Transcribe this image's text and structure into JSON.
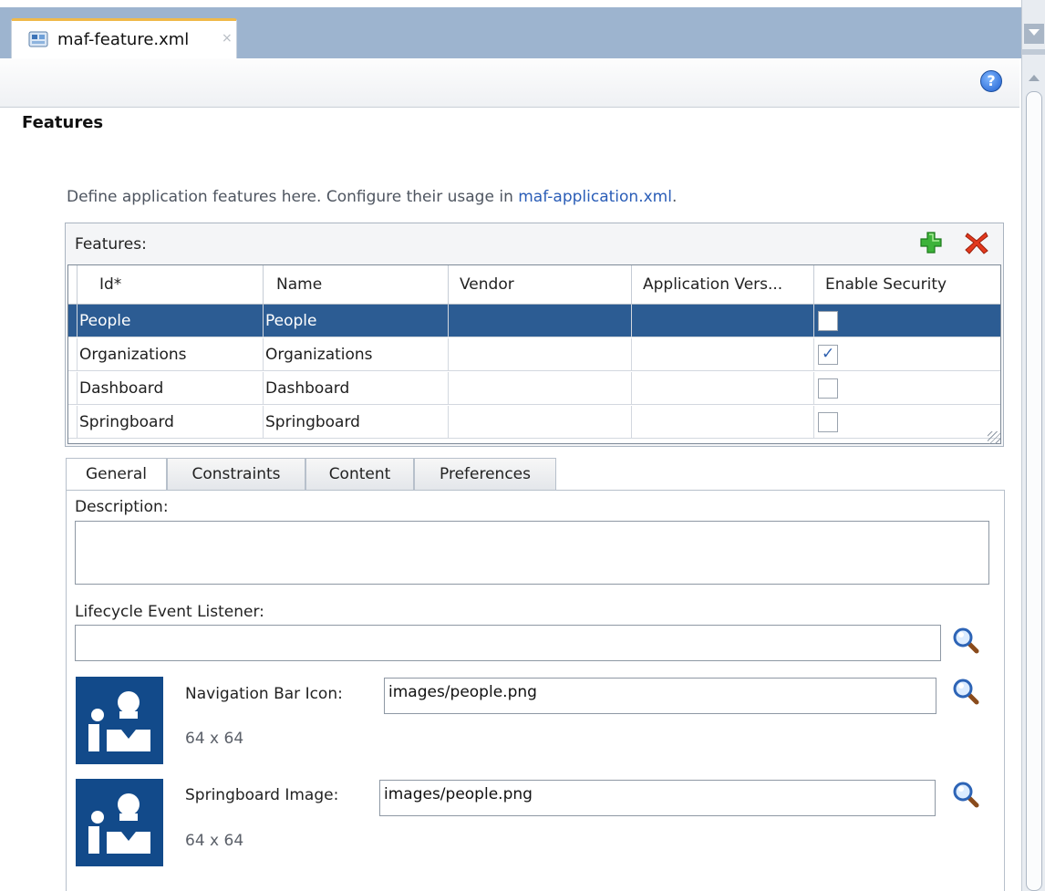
{
  "editor_tab": {
    "title": "maf-feature.xml",
    "close_glyph": "×"
  },
  "help_icon": "?",
  "section_title": "Features",
  "intro": {
    "text": "Define application features here. Configure their usage in ",
    "link": "maf-application.xml",
    "suffix": "."
  },
  "features_table": {
    "label": "Features:",
    "add_icon": "add-icon",
    "delete_icon": "delete-icon",
    "columns": [
      "Id*",
      "Name",
      "Vendor",
      "Application Vers...",
      "Enable Security"
    ],
    "rows": [
      {
        "id": "People",
        "name": "People",
        "vendor": "",
        "app_version": "",
        "enable_security": false,
        "selected": true
      },
      {
        "id": "Organizations",
        "name": "Organizations",
        "vendor": "",
        "app_version": "",
        "enable_security": true,
        "selected": false
      },
      {
        "id": "Dashboard",
        "name": "Dashboard",
        "vendor": "",
        "app_version": "",
        "enable_security": false,
        "selected": false
      },
      {
        "id": "Springboard",
        "name": "Springboard",
        "vendor": "",
        "app_version": "",
        "enable_security": false,
        "selected": false
      }
    ]
  },
  "detail_tabs": [
    {
      "label": "General",
      "active": true
    },
    {
      "label": "Constraints",
      "active": false
    },
    {
      "label": "Content",
      "active": false
    },
    {
      "label": "Preferences",
      "active": false
    }
  ],
  "general": {
    "description_label": "Description:",
    "description_value": "",
    "lifecycle_label": "Lifecycle Event Listener:",
    "lifecycle_value": "",
    "nav_icon_label": "Navigation Bar Icon:",
    "nav_icon_value": "images/people.png",
    "nav_icon_size": "64 x 64",
    "springboard_label": "Springboard Image:",
    "springboard_value": "images/people.png",
    "springboard_size": "64 x 64"
  },
  "colors": {
    "selection": "#2c5c93",
    "link": "#2a5db7",
    "tabstrip": "#9db4cf",
    "icon_tile": "#124a8a"
  }
}
